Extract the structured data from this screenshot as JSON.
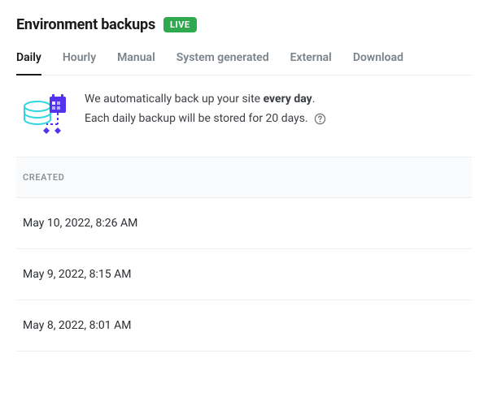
{
  "header": {
    "title": "Environment backups",
    "badge": "LIVE"
  },
  "tabs": [
    {
      "label": "Daily",
      "active": true
    },
    {
      "label": "Hourly",
      "active": false
    },
    {
      "label": "Manual",
      "active": false
    },
    {
      "label": "System generated",
      "active": false
    },
    {
      "label": "External",
      "active": false
    },
    {
      "label": "Download",
      "active": false
    }
  ],
  "info": {
    "line1_pre": "We automatically back up your site ",
    "line1_bold": "every day",
    "line1_post": ".",
    "line2": "Each daily backup will be stored for 20 days."
  },
  "list": {
    "column_header": "CREATED",
    "rows": [
      "May 10, 2022, 8:26 AM",
      "May 9, 2022, 8:15 AM",
      "May 8, 2022, 8:01 AM"
    ]
  }
}
